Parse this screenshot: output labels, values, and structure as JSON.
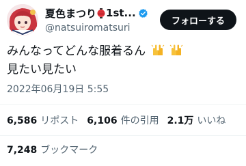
{
  "user": {
    "display_name": "夏色まつり",
    "name_suffix": "1st...",
    "handle": "@natsuiromatsuri",
    "verified": true
  },
  "follow_button": {
    "label": "フォローする"
  },
  "tweet": {
    "line1": "みんなってどんな服着るん",
    "line2": "見たい見たい",
    "emoji": [
      "raising-hands-icon",
      "raising-hands-icon"
    ]
  },
  "timestamp": "2022年06月19日 5:55",
  "stats": {
    "reposts_count": "6,586",
    "reposts_label": "リポスト",
    "quotes_count": "6,106",
    "quotes_label": "件の引用",
    "likes_count": "2.1万",
    "likes_label": "いいね",
    "bookmarks_count": "7,248",
    "bookmarks_label": "ブックマーク"
  },
  "colors": {
    "text_primary": "#0f1419",
    "text_secondary": "#536471",
    "verified_blue": "#1d9bf0",
    "divider": "#eff3f4",
    "follow_button_bg": "#0f1419"
  }
}
